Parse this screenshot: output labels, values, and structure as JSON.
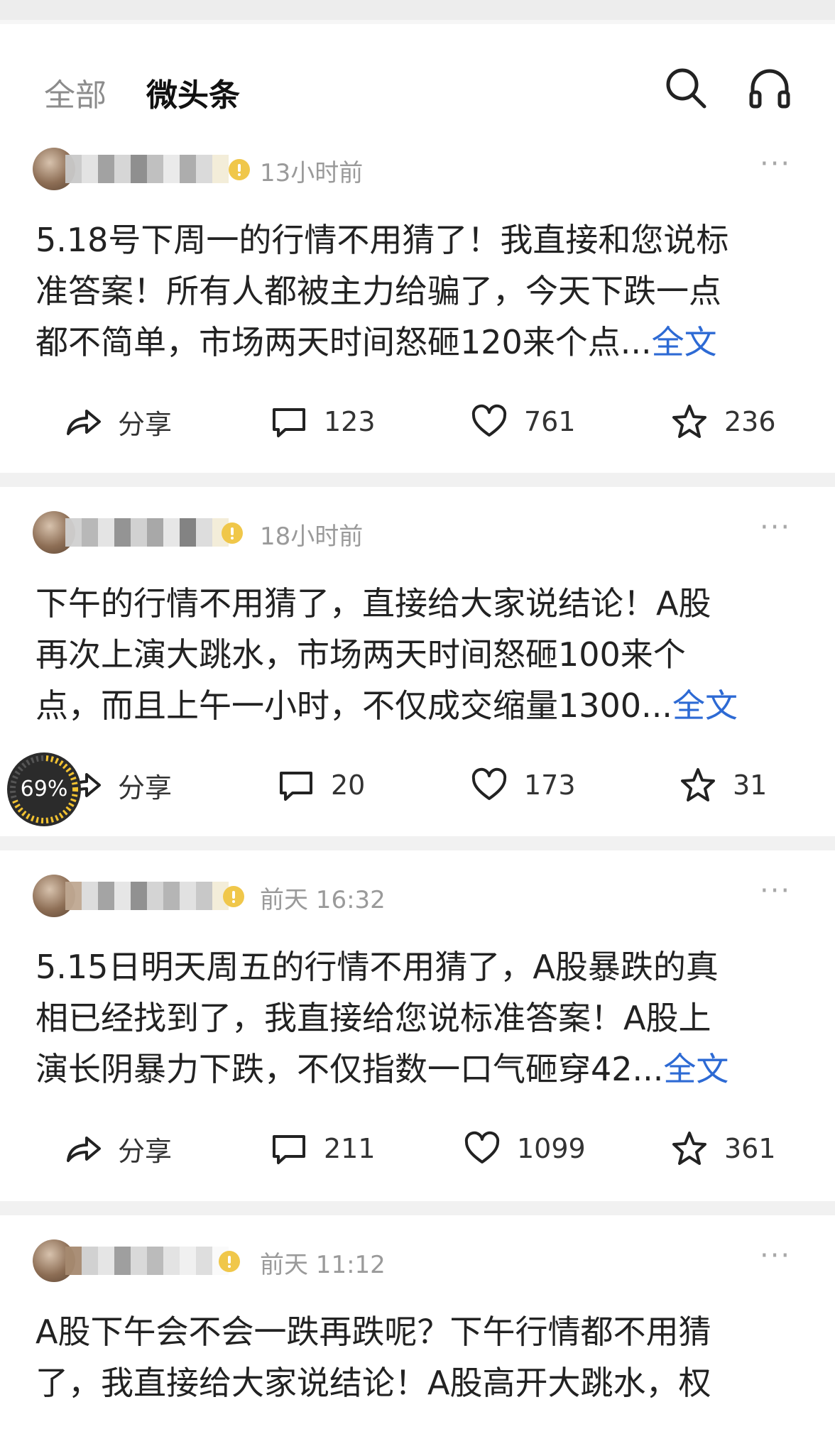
{
  "header": {
    "tab_all": "全部",
    "tab_micro": "微头条",
    "search_icon": "search-icon",
    "headphones_icon": "headphones-icon"
  },
  "actions_labels": {
    "share": "分享"
  },
  "posts": [
    {
      "time": "13小时前",
      "lines": [
        "5.18号下周一的行情不用猜了！我直接和您说标",
        "准答案！所有人都被主力给骗了，今天下跌一点",
        "都不简单，市场两天时间怒砸120来个点..."
      ],
      "fulltext": "全文",
      "comments": "123",
      "likes": "761",
      "favorites": "236"
    },
    {
      "time": "18小时前",
      "lines": [
        "下午的行情不用猜了，直接给大家说结论！A股",
        "再次上演大跳水，市场两天时间怒砸100来个",
        "点，而且上午一小时，不仅成交缩量1300..."
      ],
      "fulltext": "全文",
      "comments": "20",
      "likes": "173",
      "favorites": "31"
    },
    {
      "time": "前天  16:32",
      "lines": [
        "5.15日明天周五的行情不用猜了，A股暴跌的真",
        "相已经找到了，我直接给您说标准答案！A股上",
        "演长阴暴力下跌，不仅指数一口气砸穿42..."
      ],
      "fulltext": "全文",
      "comments": "211",
      "likes": "1099",
      "favorites": "361"
    },
    {
      "time": "前天  11:12",
      "lines": [
        "A股下午会不会一跌再跌呢？下午行情都不用猜",
        "了，我直接给大家说结论！A股高开大跳水，权"
      ]
    }
  ],
  "progress": {
    "value_percent": 69,
    "label": "69%"
  },
  "colors": {
    "link": "#2d6ad4",
    "background_gap": "#f1f1f1",
    "badge": "#f0c74a"
  }
}
